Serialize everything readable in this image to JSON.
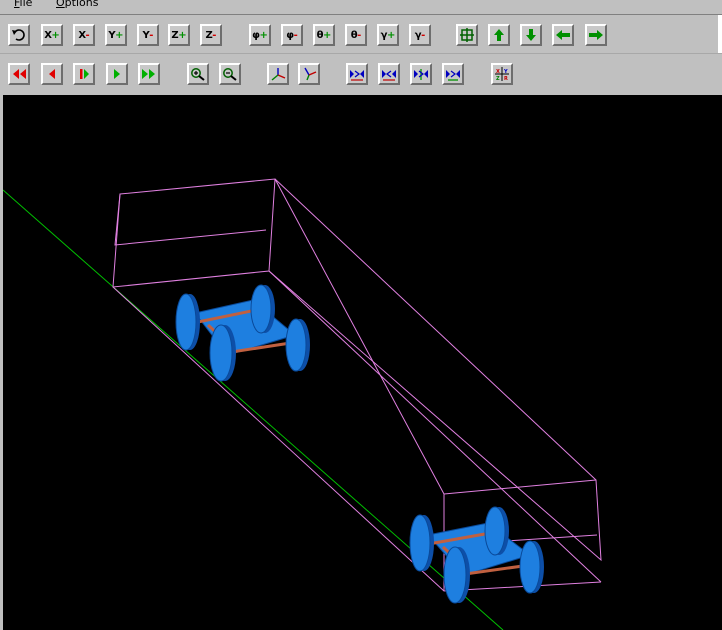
{
  "menubar": {
    "file": {
      "mnemonic": "F",
      "rest": "ile"
    },
    "options": {
      "mnemonic": "O",
      "rest": "ptions"
    }
  },
  "toolbar1": {
    "buttons": [
      {
        "id": "undo",
        "icon": "undo-arrow-icon"
      },
      {
        "id": "x-plus",
        "label": "X",
        "sign": "+"
      },
      {
        "id": "x-minus",
        "label": "X",
        "sign": "-"
      },
      {
        "id": "y-plus",
        "label": "Y",
        "sign": "+"
      },
      {
        "id": "y-minus",
        "label": "Y",
        "sign": "-"
      },
      {
        "id": "z-plus",
        "label": "Z",
        "sign": "+"
      },
      {
        "id": "z-minus",
        "label": "Z",
        "sign": "-"
      },
      {
        "id": "phi-plus",
        "label": "φ",
        "sign": "+"
      },
      {
        "id": "phi-minus",
        "label": "φ",
        "sign": "-"
      },
      {
        "id": "theta-plus",
        "label": "θ",
        "sign": "+"
      },
      {
        "id": "theta-minus",
        "label": "θ",
        "sign": "-"
      },
      {
        "id": "gamma-plus",
        "label": "γ",
        "sign": "+"
      },
      {
        "id": "gamma-minus",
        "label": "γ",
        "sign": "-"
      },
      {
        "id": "center",
        "icon": "target-grid-icon"
      },
      {
        "id": "move-up",
        "icon": "arrow-up-icon"
      },
      {
        "id": "move-down",
        "icon": "arrow-down-icon"
      },
      {
        "id": "move-left",
        "icon": "arrow-left-icon"
      },
      {
        "id": "move-right",
        "icon": "arrow-right-icon"
      }
    ]
  },
  "toolbar2": {
    "buttons": [
      {
        "id": "rewind",
        "icon": "fast-rewind-icon"
      },
      {
        "id": "step-back",
        "icon": "step-back-icon"
      },
      {
        "id": "pause",
        "icon": "pause-play-icon"
      },
      {
        "id": "play",
        "icon": "play-icon"
      },
      {
        "id": "fast-forward",
        "icon": "fast-forward-icon"
      },
      {
        "id": "zoom-in",
        "icon": "zoom-in-icon"
      },
      {
        "id": "zoom-out",
        "icon": "zoom-out-icon"
      },
      {
        "id": "axes-1",
        "icon": "axes-view-icon"
      },
      {
        "id": "axes-2",
        "icon": "axes-rotate-icon"
      },
      {
        "id": "frame-1",
        "icon": "frame-shrink-icon"
      },
      {
        "id": "frame-2",
        "icon": "frame-expand-icon"
      },
      {
        "id": "frame-3",
        "icon": "frame-vertical-icon"
      },
      {
        "id": "frame-4",
        "icon": "frame-horizontal-icon"
      },
      {
        "id": "coords",
        "icon": "xyz-coordinate-icon"
      }
    ]
  },
  "scene": {
    "background": "#000000",
    "wireframe_color": "#e080e0",
    "ground_line_color": "#00c000",
    "bogie_color": "#1e7fe0",
    "axle_color": "#c06040"
  },
  "colors": {
    "button_face": "#c8c8c8",
    "plus": "#009000",
    "minus": "#d00000",
    "media_red": "#e00000",
    "media_green": "#00b000"
  }
}
